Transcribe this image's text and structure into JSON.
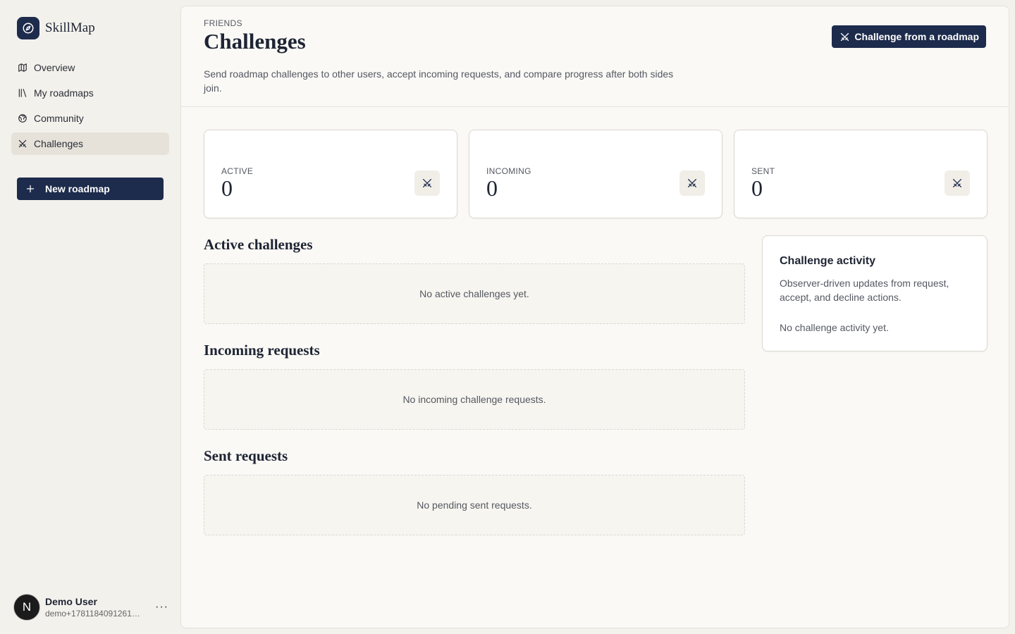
{
  "app": {
    "name": "SkillMap"
  },
  "sidebar": {
    "items": [
      {
        "label": "Overview",
        "icon": "map-icon"
      },
      {
        "label": "My roadmaps",
        "icon": "library-icon"
      },
      {
        "label": "Community",
        "icon": "globe-icon"
      },
      {
        "label": "Challenges",
        "icon": "swords-icon",
        "active": true
      }
    ],
    "new_roadmap_label": "New roadmap"
  },
  "user": {
    "initial": "N",
    "name": "Demo User",
    "email": "demo+1781184091261@s...",
    "menu_label": "···"
  },
  "header": {
    "eyebrow": "FRIENDS",
    "title": "Challenges",
    "description": "Send roadmap challenges to other users, accept incoming requests, and compare progress after both sides join.",
    "cta_label": "Challenge from a roadmap"
  },
  "stats": [
    {
      "label": "ACTIVE",
      "value": "0"
    },
    {
      "label": "INCOMING",
      "value": "0"
    },
    {
      "label": "SENT",
      "value": "0"
    }
  ],
  "sections": {
    "active": {
      "title": "Active challenges",
      "empty": "No active challenges yet."
    },
    "incoming": {
      "title": "Incoming requests",
      "empty": "No incoming challenge requests."
    },
    "sent": {
      "title": "Sent requests",
      "empty": "No pending sent requests."
    }
  },
  "activity": {
    "title": "Challenge activity",
    "description": "Observer-driven updates from request, accept, and decline actions.",
    "empty": "No challenge activity yet."
  },
  "colors": {
    "brand": "#1d2b4c",
    "background": "#f3f1ec",
    "panel": "#faf9f6",
    "active_nav": "#e6e2da"
  }
}
